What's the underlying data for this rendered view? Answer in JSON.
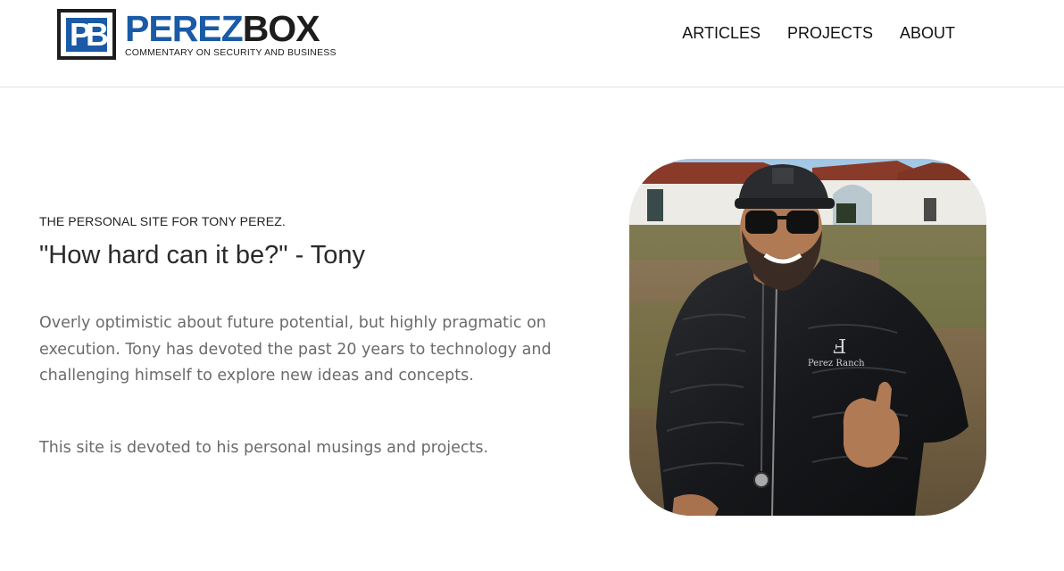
{
  "header": {
    "logo": {
      "mark_text": "PB",
      "brand_part1": "PEREZ",
      "brand_part2": "BOX",
      "tagline": "COMMENTARY ON SECURITY AND BUSINESS"
    },
    "nav": [
      {
        "label": "ARTICLES"
      },
      {
        "label": "PROJECTS"
      },
      {
        "label": "ABOUT"
      }
    ]
  },
  "main": {
    "eyebrow": "THE PERSONAL SITE FOR TONY PEREZ.",
    "quote": "\"How hard can it be?\" - Tony",
    "paragraph1": "Overly optimistic about future potential, but highly pragmatic on execution. Tony has devoted the past 20 years to technology and challenging himself to explore new ideas and concepts.",
    "paragraph2": "This site is devoted to his personal musings and projects."
  },
  "photo": {
    "jacket_text": "Perez Ranch"
  },
  "colors": {
    "brand_blue": "#1a5aa6",
    "brand_dark": "#1d1d1d",
    "body_text": "#6b6b6b"
  }
}
